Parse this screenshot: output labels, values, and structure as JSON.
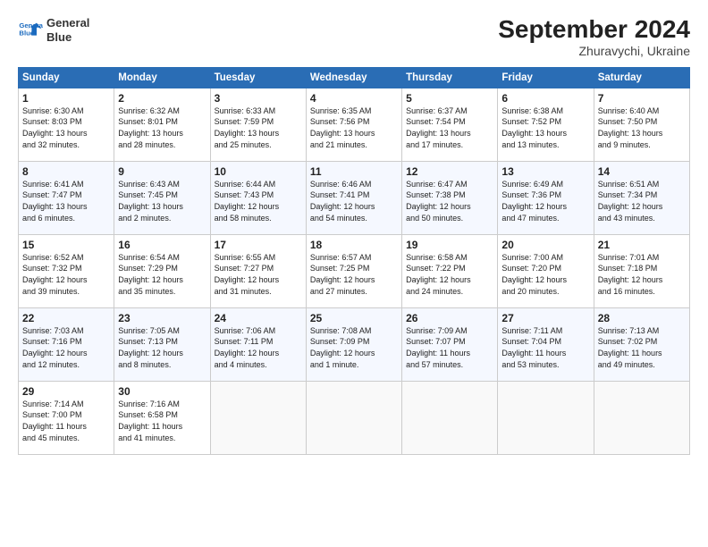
{
  "header": {
    "logo_line1": "General",
    "logo_line2": "Blue",
    "title": "September 2024",
    "subtitle": "Zhuravychi, Ukraine"
  },
  "days_of_week": [
    "Sunday",
    "Monday",
    "Tuesday",
    "Wednesday",
    "Thursday",
    "Friday",
    "Saturday"
  ],
  "weeks": [
    [
      {
        "day": "1",
        "info": "Sunrise: 6:30 AM\nSunset: 8:03 PM\nDaylight: 13 hours\nand 32 minutes."
      },
      {
        "day": "2",
        "info": "Sunrise: 6:32 AM\nSunset: 8:01 PM\nDaylight: 13 hours\nand 28 minutes."
      },
      {
        "day": "3",
        "info": "Sunrise: 6:33 AM\nSunset: 7:59 PM\nDaylight: 13 hours\nand 25 minutes."
      },
      {
        "day": "4",
        "info": "Sunrise: 6:35 AM\nSunset: 7:56 PM\nDaylight: 13 hours\nand 21 minutes."
      },
      {
        "day": "5",
        "info": "Sunrise: 6:37 AM\nSunset: 7:54 PM\nDaylight: 13 hours\nand 17 minutes."
      },
      {
        "day": "6",
        "info": "Sunrise: 6:38 AM\nSunset: 7:52 PM\nDaylight: 13 hours\nand 13 minutes."
      },
      {
        "day": "7",
        "info": "Sunrise: 6:40 AM\nSunset: 7:50 PM\nDaylight: 13 hours\nand 9 minutes."
      }
    ],
    [
      {
        "day": "8",
        "info": "Sunrise: 6:41 AM\nSunset: 7:47 PM\nDaylight: 13 hours\nand 6 minutes."
      },
      {
        "day": "9",
        "info": "Sunrise: 6:43 AM\nSunset: 7:45 PM\nDaylight: 13 hours\nand 2 minutes."
      },
      {
        "day": "10",
        "info": "Sunrise: 6:44 AM\nSunset: 7:43 PM\nDaylight: 12 hours\nand 58 minutes."
      },
      {
        "day": "11",
        "info": "Sunrise: 6:46 AM\nSunset: 7:41 PM\nDaylight: 12 hours\nand 54 minutes."
      },
      {
        "day": "12",
        "info": "Sunrise: 6:47 AM\nSunset: 7:38 PM\nDaylight: 12 hours\nand 50 minutes."
      },
      {
        "day": "13",
        "info": "Sunrise: 6:49 AM\nSunset: 7:36 PM\nDaylight: 12 hours\nand 47 minutes."
      },
      {
        "day": "14",
        "info": "Sunrise: 6:51 AM\nSunset: 7:34 PM\nDaylight: 12 hours\nand 43 minutes."
      }
    ],
    [
      {
        "day": "15",
        "info": "Sunrise: 6:52 AM\nSunset: 7:32 PM\nDaylight: 12 hours\nand 39 minutes."
      },
      {
        "day": "16",
        "info": "Sunrise: 6:54 AM\nSunset: 7:29 PM\nDaylight: 12 hours\nand 35 minutes."
      },
      {
        "day": "17",
        "info": "Sunrise: 6:55 AM\nSunset: 7:27 PM\nDaylight: 12 hours\nand 31 minutes."
      },
      {
        "day": "18",
        "info": "Sunrise: 6:57 AM\nSunset: 7:25 PM\nDaylight: 12 hours\nand 27 minutes."
      },
      {
        "day": "19",
        "info": "Sunrise: 6:58 AM\nSunset: 7:22 PM\nDaylight: 12 hours\nand 24 minutes."
      },
      {
        "day": "20",
        "info": "Sunrise: 7:00 AM\nSunset: 7:20 PM\nDaylight: 12 hours\nand 20 minutes."
      },
      {
        "day": "21",
        "info": "Sunrise: 7:01 AM\nSunset: 7:18 PM\nDaylight: 12 hours\nand 16 minutes."
      }
    ],
    [
      {
        "day": "22",
        "info": "Sunrise: 7:03 AM\nSunset: 7:16 PM\nDaylight: 12 hours\nand 12 minutes."
      },
      {
        "day": "23",
        "info": "Sunrise: 7:05 AM\nSunset: 7:13 PM\nDaylight: 12 hours\nand 8 minutes."
      },
      {
        "day": "24",
        "info": "Sunrise: 7:06 AM\nSunset: 7:11 PM\nDaylight: 12 hours\nand 4 minutes."
      },
      {
        "day": "25",
        "info": "Sunrise: 7:08 AM\nSunset: 7:09 PM\nDaylight: 12 hours\nand 1 minute."
      },
      {
        "day": "26",
        "info": "Sunrise: 7:09 AM\nSunset: 7:07 PM\nDaylight: 11 hours\nand 57 minutes."
      },
      {
        "day": "27",
        "info": "Sunrise: 7:11 AM\nSunset: 7:04 PM\nDaylight: 11 hours\nand 53 minutes."
      },
      {
        "day": "28",
        "info": "Sunrise: 7:13 AM\nSunset: 7:02 PM\nDaylight: 11 hours\nand 49 minutes."
      }
    ],
    [
      {
        "day": "29",
        "info": "Sunrise: 7:14 AM\nSunset: 7:00 PM\nDaylight: 11 hours\nand 45 minutes."
      },
      {
        "day": "30",
        "info": "Sunrise: 7:16 AM\nSunset: 6:58 PM\nDaylight: 11 hours\nand 41 minutes."
      },
      {
        "day": "",
        "info": ""
      },
      {
        "day": "",
        "info": ""
      },
      {
        "day": "",
        "info": ""
      },
      {
        "day": "",
        "info": ""
      },
      {
        "day": "",
        "info": ""
      }
    ]
  ]
}
